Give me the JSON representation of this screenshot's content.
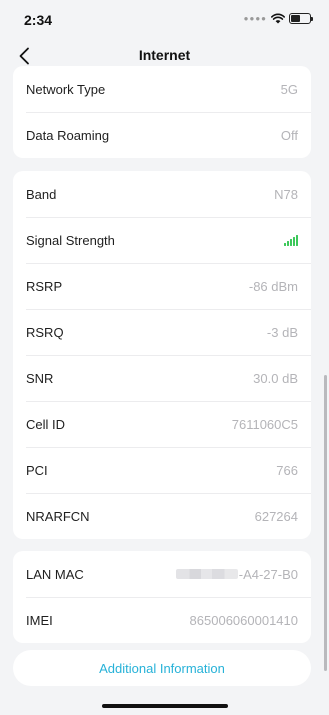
{
  "status_bar": {
    "time": "2:34"
  },
  "nav": {
    "title": "Internet"
  },
  "group1": [
    {
      "label": "Network Type",
      "value": "5G"
    },
    {
      "label": "Data Roaming",
      "value": "Off"
    }
  ],
  "group2": [
    {
      "label": "Band",
      "value": "N78"
    },
    {
      "label": "Signal Strength",
      "level": 5,
      "max_level": 5
    },
    {
      "label": "RSRP",
      "value": "-86 dBm"
    },
    {
      "label": "RSRQ",
      "value": "-3 dB"
    },
    {
      "label": "SNR",
      "value": "30.0 dB"
    },
    {
      "label": "Cell ID",
      "value": "7611060C5"
    },
    {
      "label": "PCI",
      "value": "766"
    },
    {
      "label": "NRARFCN",
      "value": "627264"
    }
  ],
  "group3": [
    {
      "label": "LAN MAC",
      "value": "-A4-27-B0"
    },
    {
      "label": "IMEI",
      "value": "865006060001410"
    }
  ],
  "additional_info_label": "Additional Information",
  "colors": {
    "accent": "#27b2d8",
    "signal": "#3cc85a",
    "background": "#f3f4f6"
  },
  "icons": {
    "back": "chevron-left-icon",
    "wifi": "wifi-icon",
    "battery": "battery-icon",
    "signal": "signal-bars-icon"
  }
}
